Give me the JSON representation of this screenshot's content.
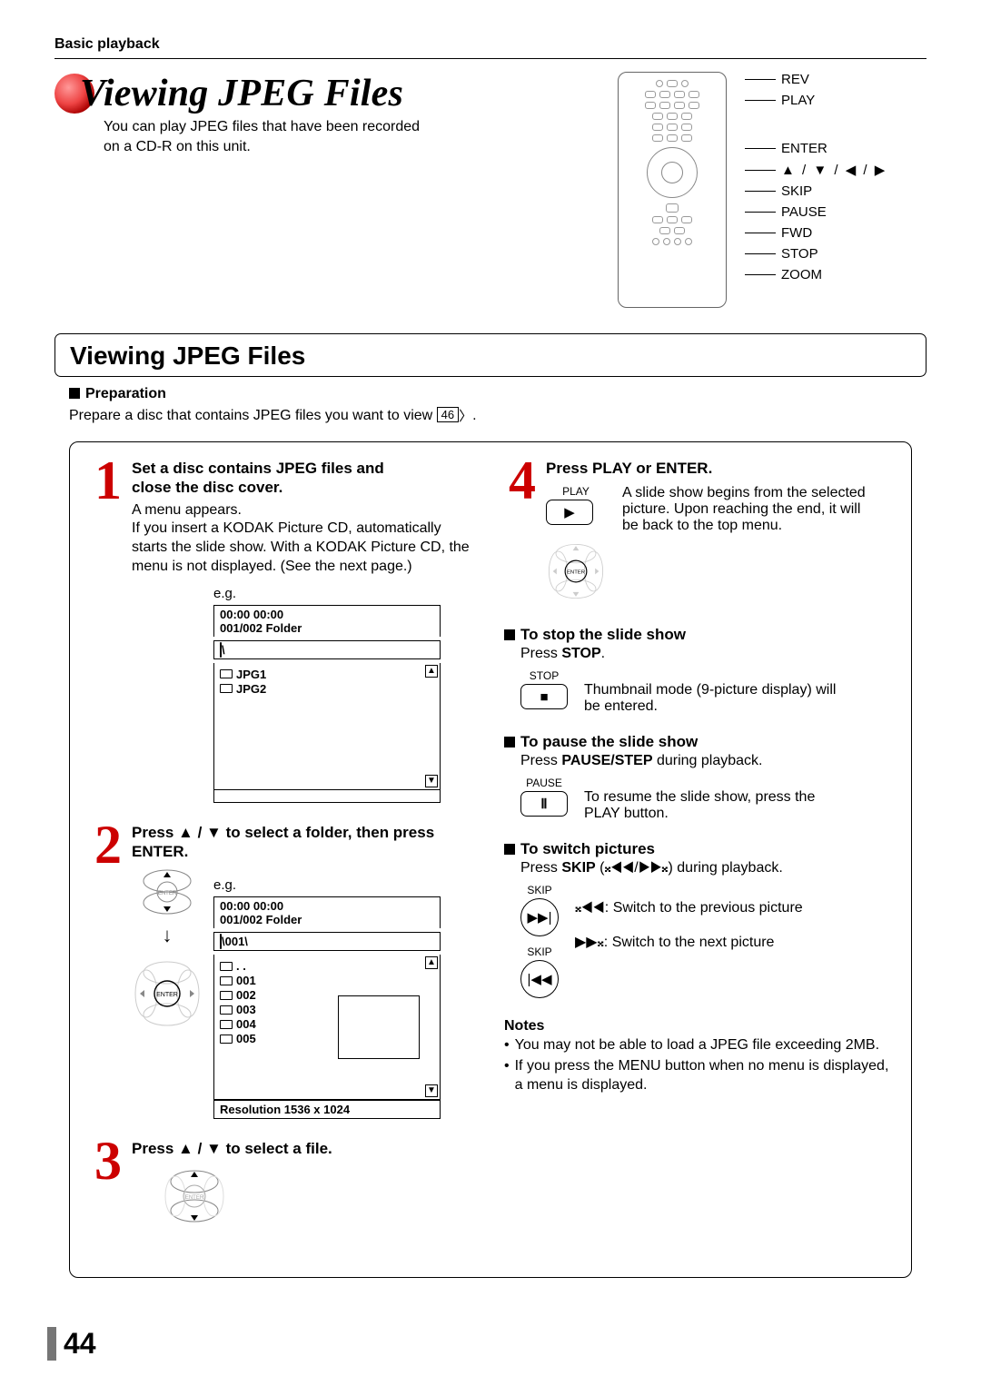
{
  "breadcrumb": "Basic playback",
  "pageTitle": "Viewing JPEG Files",
  "subtitle_l1": "You can play JPEG files that have been recorded",
  "subtitle_l2": "on a CD-R on this unit.",
  "remoteLabels": {
    "rev": "REV",
    "play": "PLAY",
    "enter": "ENTER",
    "arrows": "▲ / ▼ / ◀ / ▶",
    "skip": "SKIP",
    "pause": "PAUSE",
    "fwd": "FWD",
    "stop": "STOP",
    "zoom": "ZOOM"
  },
  "sectionTitle": "Viewing JPEG Files",
  "prep": {
    "head": "Preparation",
    "text_a": "Prepare a disc that contains JPEG files you want to view ",
    "pageref": "46",
    "text_b": "."
  },
  "step1": {
    "num": "1",
    "title_a": "Set a disc contains JPEG files and",
    "title_b": "close the disc cover.",
    "body_l1": "A menu appears.",
    "body_l2": "If you insert a KODAK Picture CD, automatically",
    "body_l3": "starts the slide show. With a KODAK Picture CD, the",
    "body_l4": "menu is not displayed. (See the next page.)",
    "eg": "e.g.",
    "osd_line1": "00:00     00:00",
    "osd_line2": "001/002   Folder",
    "osd_root": "\\",
    "osd_items": [
      "JPG1",
      "JPG2"
    ]
  },
  "step2": {
    "num": "2",
    "title_a": "Press ▲ / ▼ to select a folder, then press",
    "title_b": "ENTER.",
    "eg": "e.g.",
    "osd_line1": "00:00     00:00",
    "osd_line2": "001/002   Folder",
    "osd_root": "\\001\\",
    "osd_items": [
      ". .",
      "001",
      "002",
      "003",
      "004",
      "005"
    ],
    "osd_footer": "Resolution 1536 x 1024",
    "enter_label": "ENTER"
  },
  "step3": {
    "num": "3",
    "title": "Press ▲ / ▼ to select a file.",
    "enter_label": "ENTER"
  },
  "step4": {
    "num": "4",
    "title": "Press PLAY or ENTER.",
    "play_label": "PLAY",
    "enter_label": "ENTER",
    "body_l1": "A slide show begins from the selected",
    "body_l2": "picture. Upon reaching the end, it will",
    "body_l3": "be back to the top menu."
  },
  "stopSlide": {
    "head": "To stop the slide show",
    "text_a": "Press ",
    "bold": "STOP",
    "text_b": ".",
    "stop_label": "STOP",
    "desc_l1": "Thumbnail mode (9-picture display) will",
    "desc_l2": "be entered."
  },
  "pauseSlide": {
    "head": "To pause the slide show",
    "text_a": "Press ",
    "bold": "PAUSE/STEP",
    "text_b": " during playback.",
    "pause_label": "PAUSE",
    "desc_l1": "To resume the slide show, press the",
    "desc_l2": "PLAY button."
  },
  "switchPic": {
    "head": "To switch pictures",
    "text_a": "Press ",
    "bold": "SKIP",
    "text_b": " (𝄪◀◀/▶▶𝄪)  during playback.",
    "skip_label": "SKIP",
    "prev": "𝄪◀◀: Switch to the previous picture",
    "next": "▶▶𝄪: Switch to the next picture"
  },
  "notes": {
    "head": "Notes",
    "n1": "You may not be able to load a JPEG file exceeding 2MB.",
    "n2": "If you press the MENU button when no menu is displayed, a menu is displayed."
  },
  "pageNumber": "44"
}
